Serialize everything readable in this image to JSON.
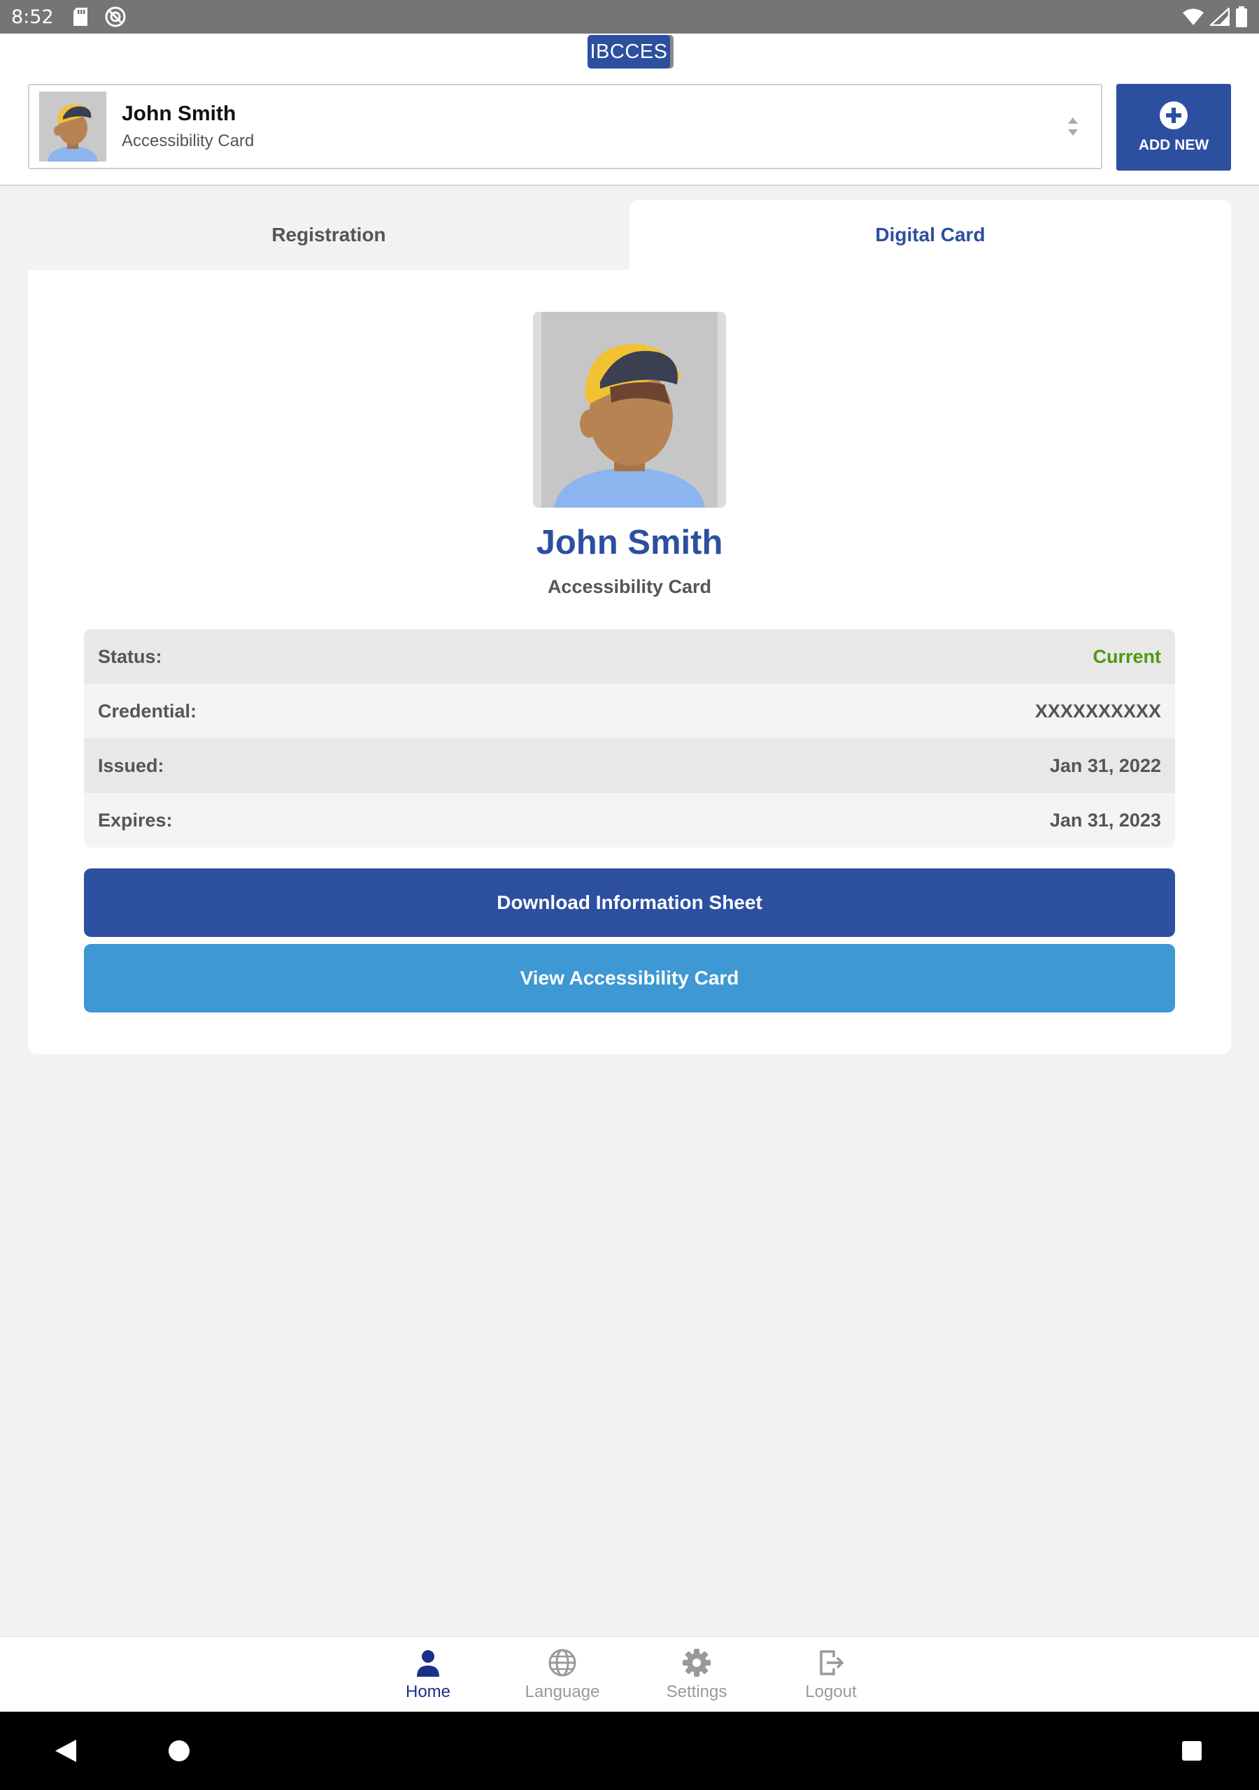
{
  "status_bar": {
    "time": "8:52"
  },
  "header": {
    "logo_text": "IBCCES",
    "profile_selector": {
      "name": "John Smith",
      "subtitle": "Accessibility Card"
    },
    "add_new_label": "ADD NEW"
  },
  "tabs": [
    {
      "label": "Registration",
      "active": false
    },
    {
      "label": "Digital Card",
      "active": true
    }
  ],
  "card": {
    "name": "John Smith",
    "subtitle": "Accessibility Card",
    "rows": [
      {
        "label": "Status:",
        "value": "Current"
      },
      {
        "label": "Credential:",
        "value": "XXXXXXXXXX"
      },
      {
        "label": "Issued:",
        "value": "Jan 31, 2022"
      },
      {
        "label": "Expires:",
        "value": "Jan 31, 2023"
      }
    ],
    "download_button": "Download Information Sheet",
    "view_button": "View Accessibility Card"
  },
  "bottom_nav": [
    {
      "label": "Home",
      "icon": "person-icon",
      "active": true
    },
    {
      "label": "Language",
      "icon": "globe-icon",
      "active": false
    },
    {
      "label": "Settings",
      "icon": "gear-icon",
      "active": false
    },
    {
      "label": "Logout",
      "icon": "logout-icon",
      "active": false
    }
  ],
  "colors": {
    "brand_blue": "#2c4fa0",
    "light_blue": "#3d98d3",
    "status_current": "#4c9a12",
    "nav_active": "#1c2f8a"
  }
}
